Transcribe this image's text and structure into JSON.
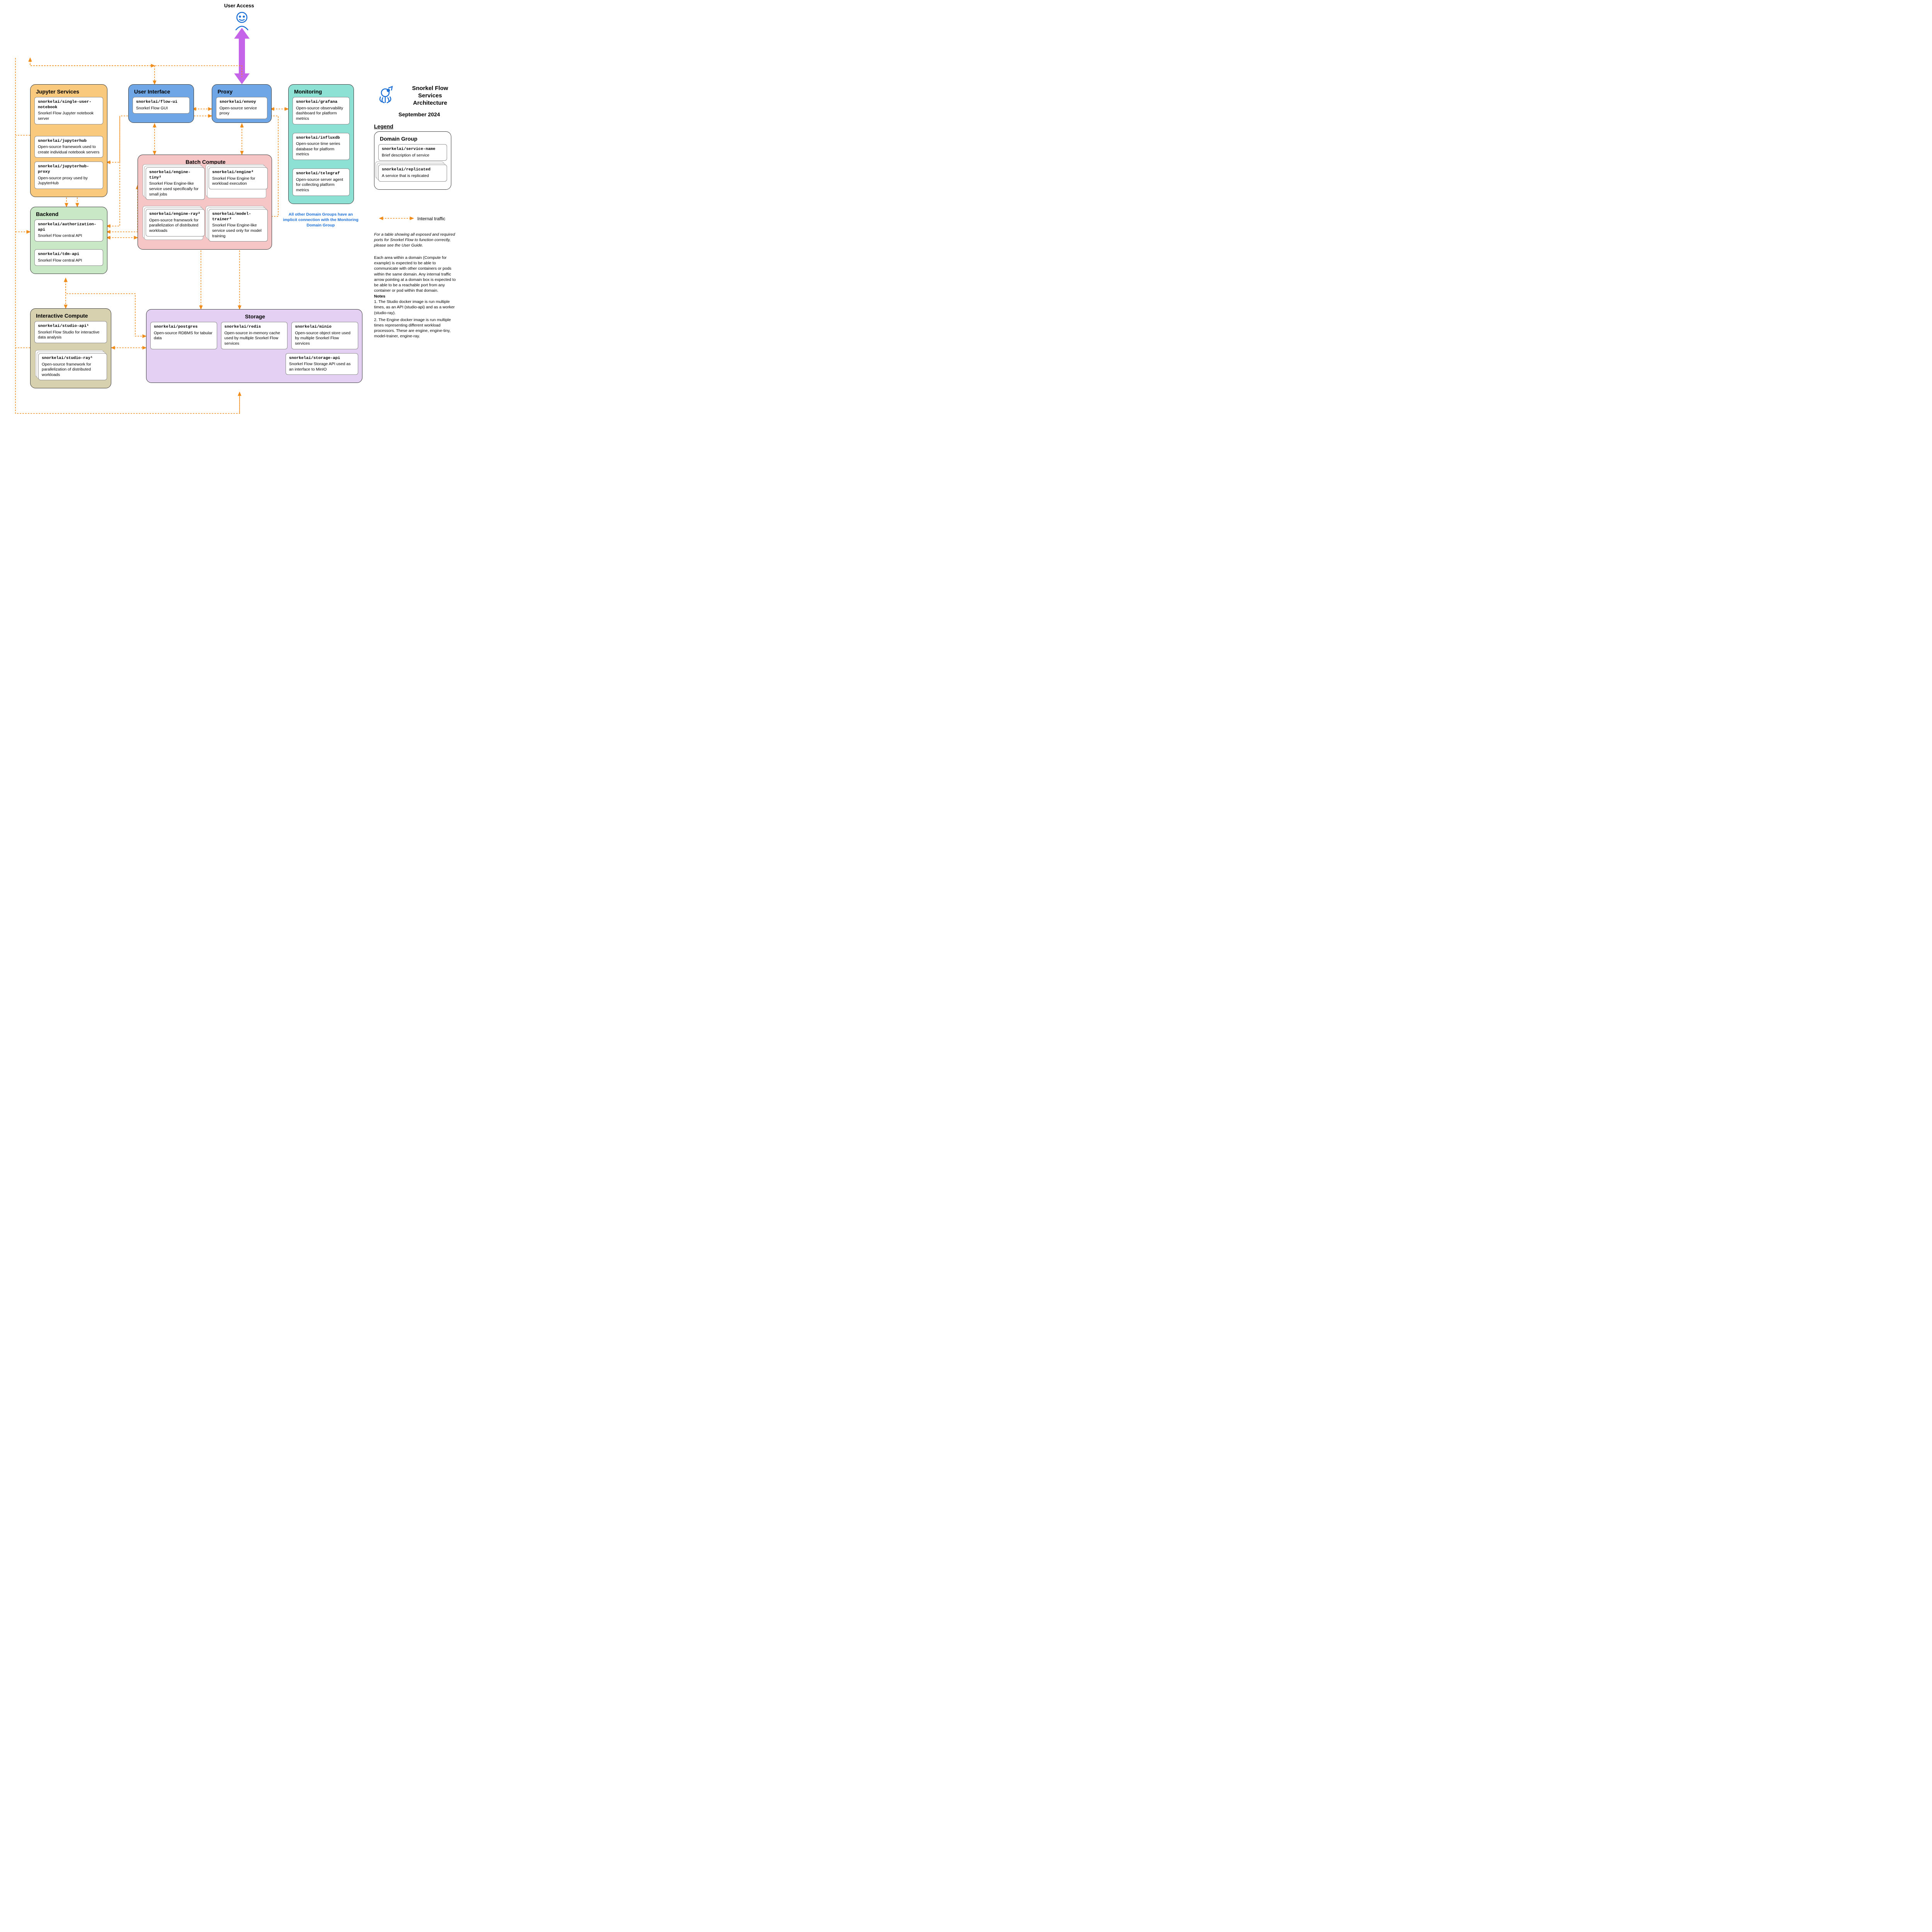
{
  "header": {
    "user_access": "User Access",
    "title1": "Snorkel Flow",
    "title2": "Services",
    "title3": "Architecture",
    "date": "September 2024"
  },
  "legend": {
    "heading": "Legend",
    "domain_title": "Domain Group",
    "svc_name": "snorkelai/service-name",
    "svc_desc": "Brief description of service",
    "rep_name": "snorkelai/replicated",
    "rep_desc": "A service that is replicated",
    "arrow_label": "Internal traffic"
  },
  "domains": {
    "jupyter": {
      "title": "Jupyter Services",
      "s1_name": "snorkelai/single-user-notebook",
      "s1_desc": "Snorkel Flow Jupyter notebook server",
      "s2_name": "snorkelai/jupyterhub",
      "s2_desc": "Open-source framework used to create individual notebook servers",
      "s3_name": "snorkelai/jupyterhub-proxy",
      "s3_desc": "Open-source proxy used by JupyterHub"
    },
    "ui": {
      "title": "User Interface",
      "s1_name": "snorkelai/flow-ui",
      "s1_desc": "Snorkel Flow GUI"
    },
    "proxy": {
      "title": "Proxy",
      "s1_name": "snorkelai/envoy",
      "s1_desc": "Open-source service proxy"
    },
    "monitoring": {
      "title": "Monitoring",
      "s1_name": "snorkelai/grafana",
      "s1_desc": "Open-source observability dashboard for platform metrics",
      "s2_name": "snorkelai/influxdb",
      "s2_desc": "Open-source time series database for platform metrics",
      "s3_name": "snorkelai/telegraf",
      "s3_desc": "Open-source server agent for collecting platform metrics",
      "note": "All other Domain Groups have an implicit connection with the Monitoring Domain Group"
    },
    "backend": {
      "title": "Backend",
      "s1_name": "snorkelai/authorization-api",
      "s1_desc": "Snorkel Flow central API",
      "s2_name": "snorkelai/tdm-api",
      "s2_desc": "Snorkel Flow central API"
    },
    "batch": {
      "title": "Batch Compute",
      "s1_name": "snorkelai/engine-tiny²",
      "s1_desc": "Snorkel Flow Engine-like service used specifically for small jobs",
      "s2_name": "snorkelai/engine²",
      "s2_desc": "Snorkel Flow Engine for workload execution",
      "s3_name": "snorkelai/engine-ray²",
      "s3_desc": "Open-source framework for parallelization of distributed workloads",
      "s4_name": "snorkelai/model-trainer²",
      "s4_desc": "Snorkel Flow Engine-like service used only for model training"
    },
    "interactive": {
      "title": "Interactive Compute",
      "s1_name": "snorkelai/studio-api¹",
      "s1_desc": "Snorkel Flow Studio for interactive data analysis",
      "s2_name": "snorkelai/studio-ray¹",
      "s2_desc": "Open-source framework for parallelization of distributed workloads"
    },
    "storage": {
      "title": "Storage",
      "s1_name": "snorkelai/postgres",
      "s1_desc": "Open-source RDBMS for tabular data",
      "s2_name": "snorkelai/redis",
      "s2_desc": "Open-source in-memory cache used by multiple Snorkel Flow services",
      "s3_name": "snorkelai/minio",
      "s3_desc": "Open-source object store used by multiple Snorkel Flow services",
      "s4_name": "snorkelai/storage-api",
      "s4_desc": "Snorkel Flow Storage API used as an interface to MinIO"
    }
  },
  "sidebar_notes": {
    "p1": "For a table showing all exposed and required ports for Snorkel Flow to function correctly, please see the User Guide.",
    "p2": "Each area within a domain (Compute for example) is expected to be able to communicate with other containers or pods within the same domain. Any internal traffic arrow pointing at a domain box is expected to be able to be a reachable port from any container or pod within that domain.",
    "notes_heading": "Notes",
    "n1": "1. The Studio docker image is run multiple times, as an API (studio-api) and as a worker (studio-ray).",
    "n2": "2. The Engine docker image is run multiple times representing different workload processors. These are engine, engine-tiny, model-trainer, engine-ray."
  },
  "colors": {
    "jupyter": "#f9c97e",
    "ui": "#6fa7e6",
    "proxy": "#6fa7e6",
    "monitoring": "#8de0d4",
    "backend": "#c9e8c5",
    "batch": "#f6c6c6",
    "interactive": "#d7d1b0",
    "storage": "#e3d0f2",
    "arrow": "#f08c1a",
    "user_arrow": "#c564e8",
    "logo": "#1a6fd6"
  }
}
